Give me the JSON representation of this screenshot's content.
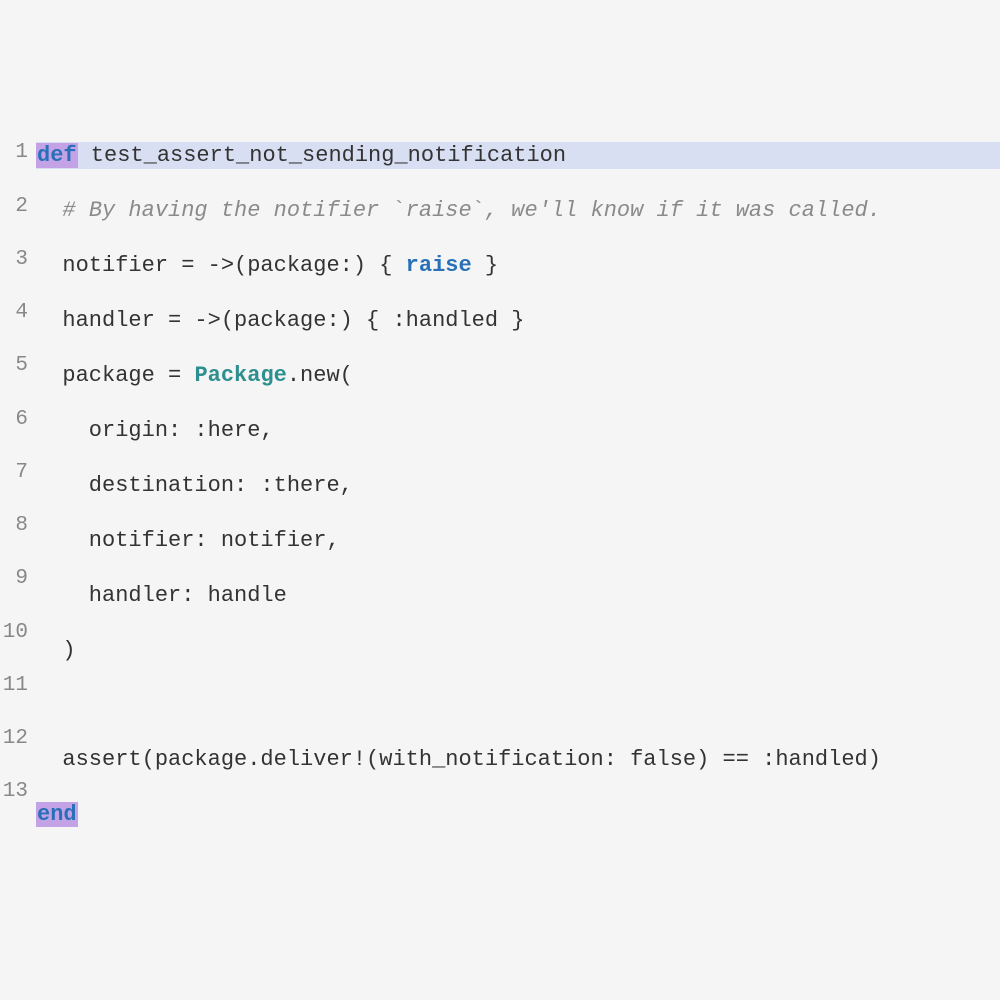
{
  "lines": {
    "n1": "1",
    "n2": "2",
    "n3": "3",
    "n4": "4",
    "n5": "5",
    "n6": "6",
    "n7": "7",
    "n8": "8",
    "n9": "9",
    "n10": "10",
    "n11": "11",
    "n12": "12",
    "n13": "13"
  },
  "tok": {
    "def": "def",
    "method_name": " test_assert_not_sending_notification",
    "comment_lead": "  # ",
    "comment_text_a": "By having the notifier ",
    "backtick1": "`",
    "comment_raise": "raise",
    "backtick2": "`",
    "comment_text_b": ", we'll know if it was called.",
    "l3_a": "  notifier = ->(package:) { ",
    "l3_raise": "raise",
    "l3_b": " }",
    "l4": "  handler = ->(package:) { :handled }",
    "l5_a": "  package = ",
    "l5_const": "Package",
    "l5_b": ".new(",
    "l6": "    origin: :here,",
    "l7": "    destination: :there,",
    "l8": "    notifier: notifier,",
    "l9": "    handler: handle",
    "l10": "  )",
    "l11": "",
    "l12": "  assert(package.deliver!(with_notification: false) == :handled)",
    "end": "end"
  }
}
